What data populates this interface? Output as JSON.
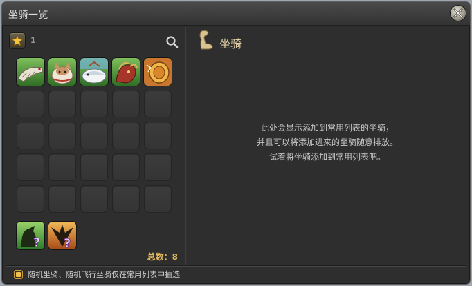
{
  "window": {
    "title": "坐骑一览"
  },
  "left": {
    "favorites_count": "1",
    "mounts": [
      {
        "icon": "mount-dragon-skeleton-icon"
      },
      {
        "icon": "mount-fat-cat-icon"
      },
      {
        "icon": "mount-whale-icon"
      },
      {
        "icon": "mount-red-beast-icon"
      },
      {
        "icon": "mount-golden-disc-icon"
      }
    ],
    "empty_slots": 20,
    "random_mounts": [
      {
        "icon": "random-ground-mount-icon"
      },
      {
        "icon": "random-flying-mount-icon"
      }
    ],
    "total_label": "总数：8"
  },
  "right": {
    "title": "坐骑",
    "message_lines": [
      "此处会显示添加到常用列表的坐骑，",
      "并且可以将添加进来的坐骑随意排放。",
      "试着将坐骑添加到常用列表吧。"
    ]
  },
  "footer": {
    "checkbox_label": "随机坐骑、随机飞行坐骑仅在常用列表中抽选",
    "checked": true
  },
  "colors": {
    "accent_gold": "#e4b95d",
    "panel_bg": "#2e2e2e"
  }
}
